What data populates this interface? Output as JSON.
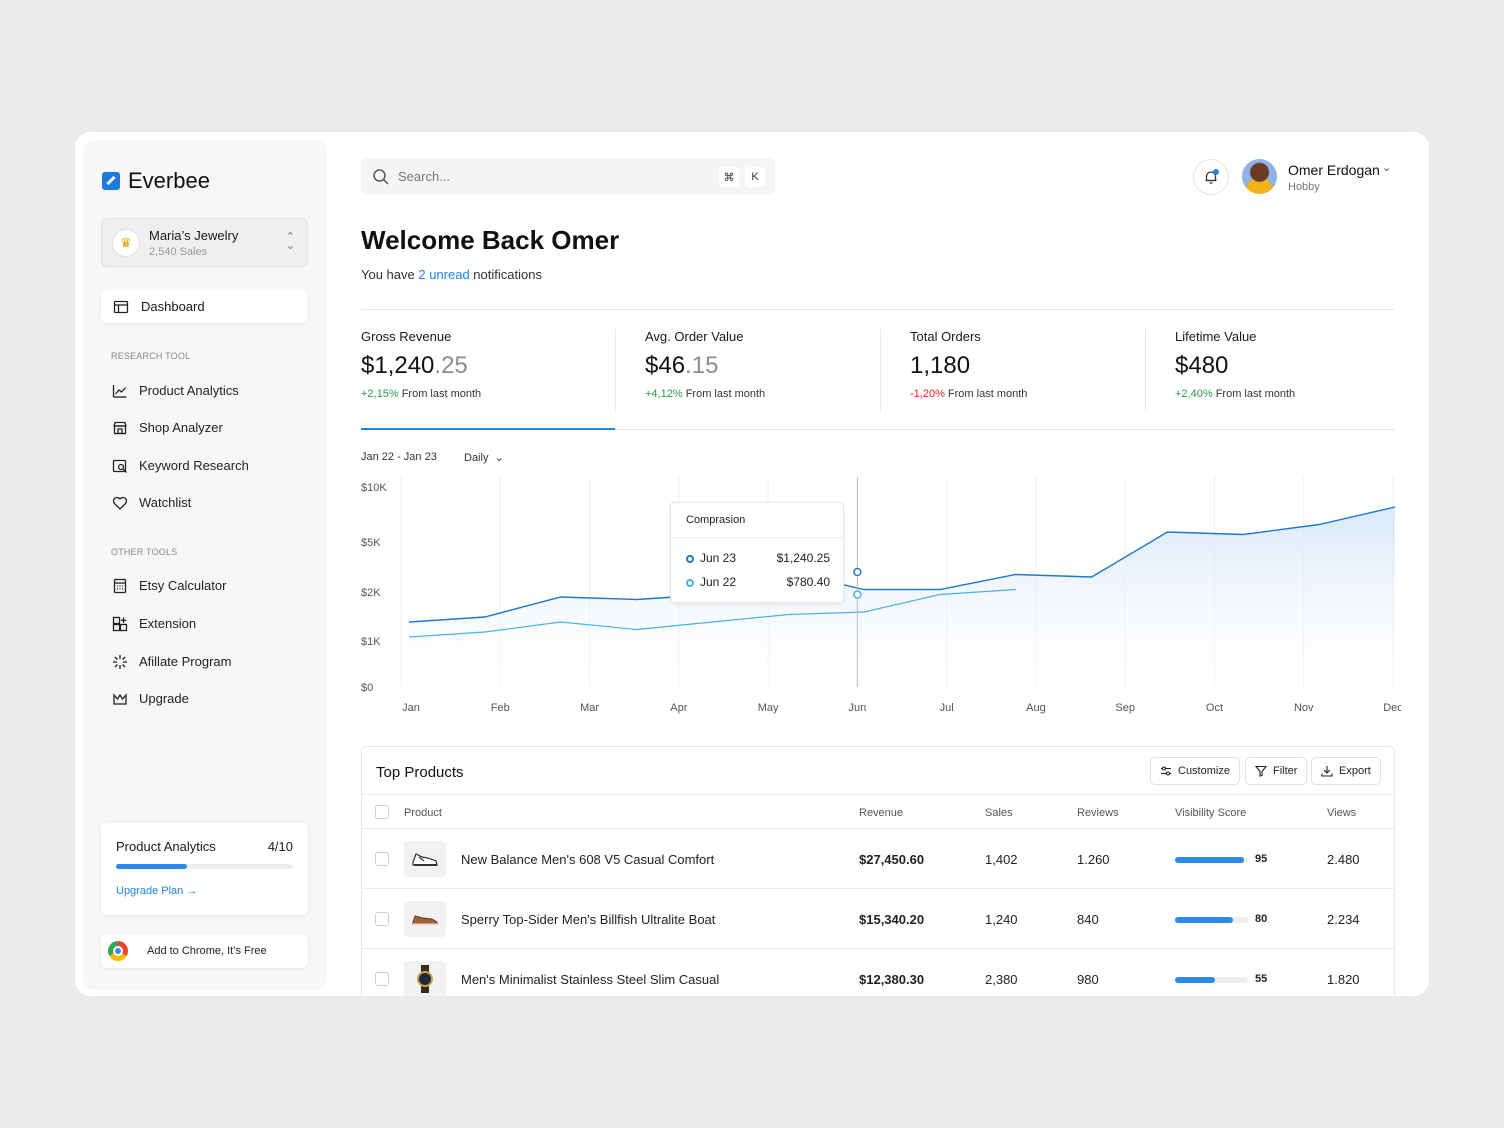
{
  "sidebar": {
    "brand": "Everbee",
    "store": {
      "name": "Maria’s Jewelry",
      "sub": "2,540 Sales"
    },
    "active_item": "Dashboard",
    "research_label": "RESEARCH TOOL",
    "research_items": [
      "Product Analytics",
      "Shop Analyzer",
      "Keyword Research",
      "Watchlist"
    ],
    "other_label": "OTHER TOOLS",
    "other_items": [
      "Etsy Calculator",
      "Extension",
      "Afillate Program",
      "Upgrade"
    ],
    "usage": {
      "title": "Product Analytics",
      "count": "4/10",
      "progress": 0.4,
      "link": "Upgrade Plan"
    },
    "chrome": "Add to Chrome, It’s Free"
  },
  "header": {
    "search_placeholder": "Search...",
    "kbd_cmd": "⌘",
    "kbd_k": "K",
    "user_name": "Omer Erdogan",
    "user_plan": "Hobby"
  },
  "welcome": {
    "title": "Welcome Back Omer",
    "pre": "You have ",
    "link": "2 unread",
    "post": " notifications"
  },
  "stats": [
    {
      "label": "Gross Revenue",
      "main": "$1,240",
      "dec": ".25",
      "change": "+2,15%",
      "trend": "pos",
      "suffix": "From last month"
    },
    {
      "label": "Avg. Order Value",
      "main": "$46",
      "dec": ".15",
      "change": "+4,12%",
      "trend": "pos",
      "suffix": "From last month"
    },
    {
      "label": "Total Orders",
      "main": "1,180",
      "dec": "",
      "change": "-1,20%",
      "trend": "neg",
      "suffix": "From last month"
    },
    {
      "label": "Lifetime Value",
      "main": "$480",
      "dec": "",
      "change": "+2,40%",
      "trend": "pos",
      "suffix": "From last month"
    }
  ],
  "chart_controls": {
    "range": "Jan 22 - Jan 23",
    "period": "Daily"
  },
  "chart_data": {
    "type": "area",
    "x": [
      "Jan",
      "Feb",
      "Mar",
      "Apr",
      "May",
      "Jun",
      "Jul",
      "Aug",
      "Sep",
      "Oct",
      "Nov",
      "Dec"
    ],
    "yticks": [
      "$10K",
      "$5K",
      "$2K",
      "$1K",
      "$0"
    ],
    "series": [
      {
        "name": "Jun 23",
        "color": "#1f78c8",
        "values": [
          1.3,
          1.4,
          1.8,
          1.75,
          1.85,
          2.3,
          1.95,
          1.95,
          2.25,
          2.2,
          3.1,
          3.05,
          3.25,
          3.6
        ]
      },
      {
        "name": "Jun 22",
        "color": "#4bb0e8",
        "values": [
          1.0,
          1.1,
          1.3,
          1.15,
          1.3,
          1.45,
          1.5,
          1.85,
          1.95
        ]
      }
    ],
    "tooltip": {
      "title": "Comprasion",
      "rows": [
        {
          "label": "Jun 23",
          "value": "$1,240.25",
          "color": "#1f78c8"
        },
        {
          "label": "Jun 22",
          "value": "$780.40",
          "color": "#4bb0e8"
        }
      ]
    }
  },
  "table": {
    "title": "Top Products",
    "buttons": [
      "Customize",
      "Filter",
      "Export"
    ],
    "headers": [
      "Product",
      "Revenue",
      "Sales",
      "Reviews",
      "Visibility Score",
      "Views"
    ],
    "rows": [
      {
        "product": "New Balance Men's 608 V5 Casual Comfort",
        "revenue": "$27,450.60",
        "sales": "1,402",
        "reviews": "1.260",
        "score": "95",
        "views": "2.480",
        "icon": "sneaker-icon"
      },
      {
        "product": "Sperry Top-Sider Men's Billfish Ultralite Boat",
        "revenue": "$15,340.20",
        "sales": "1,240",
        "reviews": "840",
        "score": "80",
        "views": "2.234",
        "icon": "boat-shoe-icon"
      },
      {
        "product": "Men's Minimalist Stainless Steel Slim Casual",
        "revenue": "$12,380.30",
        "sales": "2,380",
        "reviews": "980",
        "score": "55",
        "views": "1.820",
        "icon": "watch-icon"
      }
    ]
  }
}
